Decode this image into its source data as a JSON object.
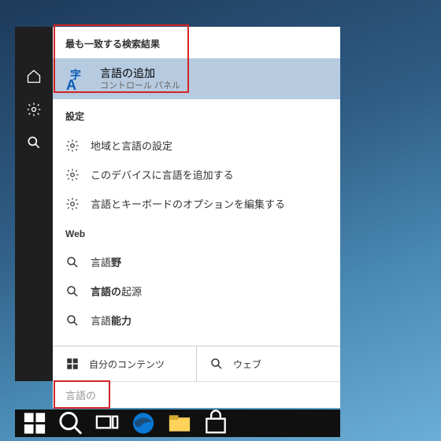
{
  "best_match": {
    "section_label": "最も一致する検索結果",
    "title": "言語の追加",
    "subtitle": "コントロール パネル"
  },
  "settings": {
    "section_label": "設定",
    "items": [
      "地域と言語の設定",
      "このデバイスに言語を追加する",
      "言語とキーボードのオプションを編集する"
    ]
  },
  "web": {
    "section_label": "Web",
    "items": [
      {
        "prefix": "言語",
        "suffix": "野"
      },
      {
        "prefix": "言語の",
        "suffix": "起源"
      },
      {
        "prefix": "言語",
        "suffix": "能力"
      }
    ]
  },
  "bottom_tabs": {
    "my_stuff": "自分のコンテンツ",
    "web": "ウェブ"
  },
  "search": {
    "value": "言語の"
  }
}
